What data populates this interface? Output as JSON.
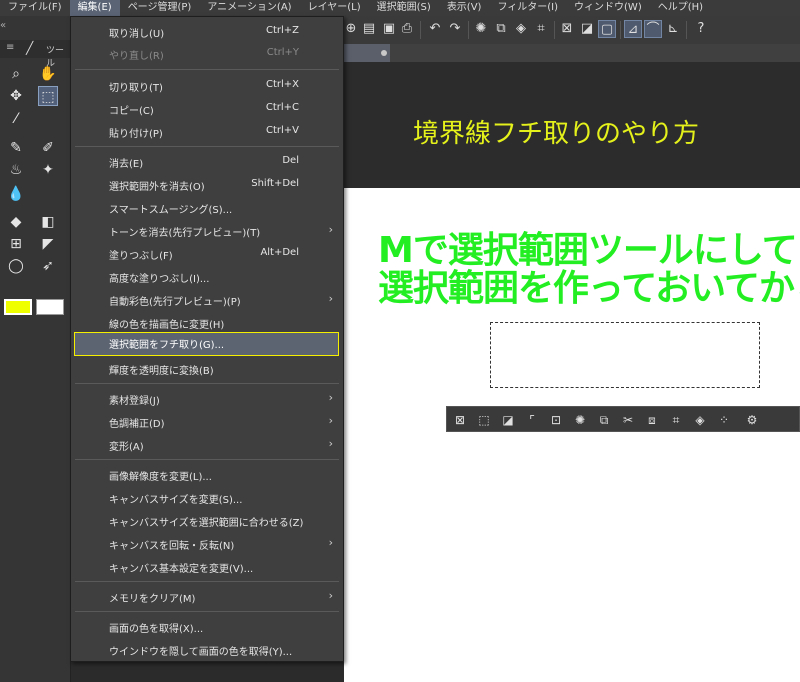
{
  "menubar": {
    "items": [
      "ファイル(F)",
      "編集(E)",
      "ページ管理(P)",
      "アニメーション(A)",
      "レイヤー(L)",
      "選択範囲(S)",
      "表示(V)",
      "フィルター(I)",
      "ウィンドウ(W)",
      "ヘルプ(H)"
    ],
    "active_index": 1
  },
  "tool_panel": {
    "header_label": "ツール"
  },
  "edit_menu": {
    "items": [
      {
        "label": "取り消し(U)",
        "shortcut": "Ctrl+Z",
        "disabled": false
      },
      {
        "label": "やり直し(R)",
        "shortcut": "Ctrl+Y",
        "disabled": true
      },
      {
        "label": "切り取り(T)",
        "shortcut": "Ctrl+X",
        "disabled": false
      },
      {
        "label": "コピー(C)",
        "shortcut": "Ctrl+C",
        "disabled": false
      },
      {
        "label": "貼り付け(P)",
        "shortcut": "Ctrl+V",
        "disabled": false
      },
      {
        "label": "消去(E)",
        "shortcut": "Del",
        "disabled": false
      },
      {
        "label": "選択範囲外を消去(O)",
        "shortcut": "Shift+Del",
        "disabled": false
      },
      {
        "label": "スマートスムージング(S)...",
        "shortcut": "",
        "disabled": false
      },
      {
        "label": "トーンを消去(先行プレビュー)(T)",
        "shortcut": "",
        "disabled": false,
        "submenu": true
      },
      {
        "label": "塗りつぶし(F)",
        "shortcut": "Alt+Del",
        "disabled": false
      },
      {
        "label": "高度な塗りつぶし(I)...",
        "shortcut": "",
        "disabled": false
      },
      {
        "label": "自動彩色(先行プレビュー)(P)",
        "shortcut": "",
        "disabled": false,
        "submenu": true
      },
      {
        "label": "線の色を描画色に変更(H)",
        "shortcut": "",
        "disabled": false
      },
      {
        "label": "選択範囲をフチ取り(G)...",
        "shortcut": "",
        "disabled": false,
        "highlighted": true
      },
      {
        "label": "輝度を透明度に変換(B)",
        "shortcut": "",
        "disabled": false
      },
      {
        "label": "素材登録(J)",
        "shortcut": "",
        "disabled": false,
        "submenu": true
      },
      {
        "label": "色調補正(D)",
        "shortcut": "",
        "disabled": false,
        "submenu": true
      },
      {
        "label": "変形(A)",
        "shortcut": "",
        "disabled": false,
        "submenu": true
      },
      {
        "label": "画像解像度を変更(L)...",
        "shortcut": "",
        "disabled": false
      },
      {
        "label": "キャンバスサイズを変更(S)...",
        "shortcut": "",
        "disabled": false
      },
      {
        "label": "キャンバスサイズを選択範囲に合わせる(Z)",
        "shortcut": "",
        "disabled": false
      },
      {
        "label": "キャンバスを回転・反転(N)",
        "shortcut": "",
        "disabled": false,
        "submenu": true
      },
      {
        "label": "キャンバス基本設定を変更(V)...",
        "shortcut": "",
        "disabled": false
      },
      {
        "label": "メモリをクリア(M)",
        "shortcut": "",
        "disabled": false,
        "submenu": true
      },
      {
        "label": "画面の色を取得(X)...",
        "shortcut": "",
        "disabled": false
      },
      {
        "label": "ウインドウを隠して画面の色を取得(Y)...",
        "shortcut": "",
        "disabled": false
      }
    ]
  },
  "canvas": {
    "title": "境界線フチ取りのやり方",
    "instruction_line1": "Mで選択範囲ツールにして",
    "instruction_line2": "選択範囲を作っておいてから"
  },
  "colors": {
    "menu_bg": "#3f3f3f",
    "highlight_border": "#f5f000",
    "title_text": "#e4f11a",
    "instruction_text": "#22ee22",
    "primary_color": "#f0ff00",
    "secondary_color": "#ffffff"
  }
}
